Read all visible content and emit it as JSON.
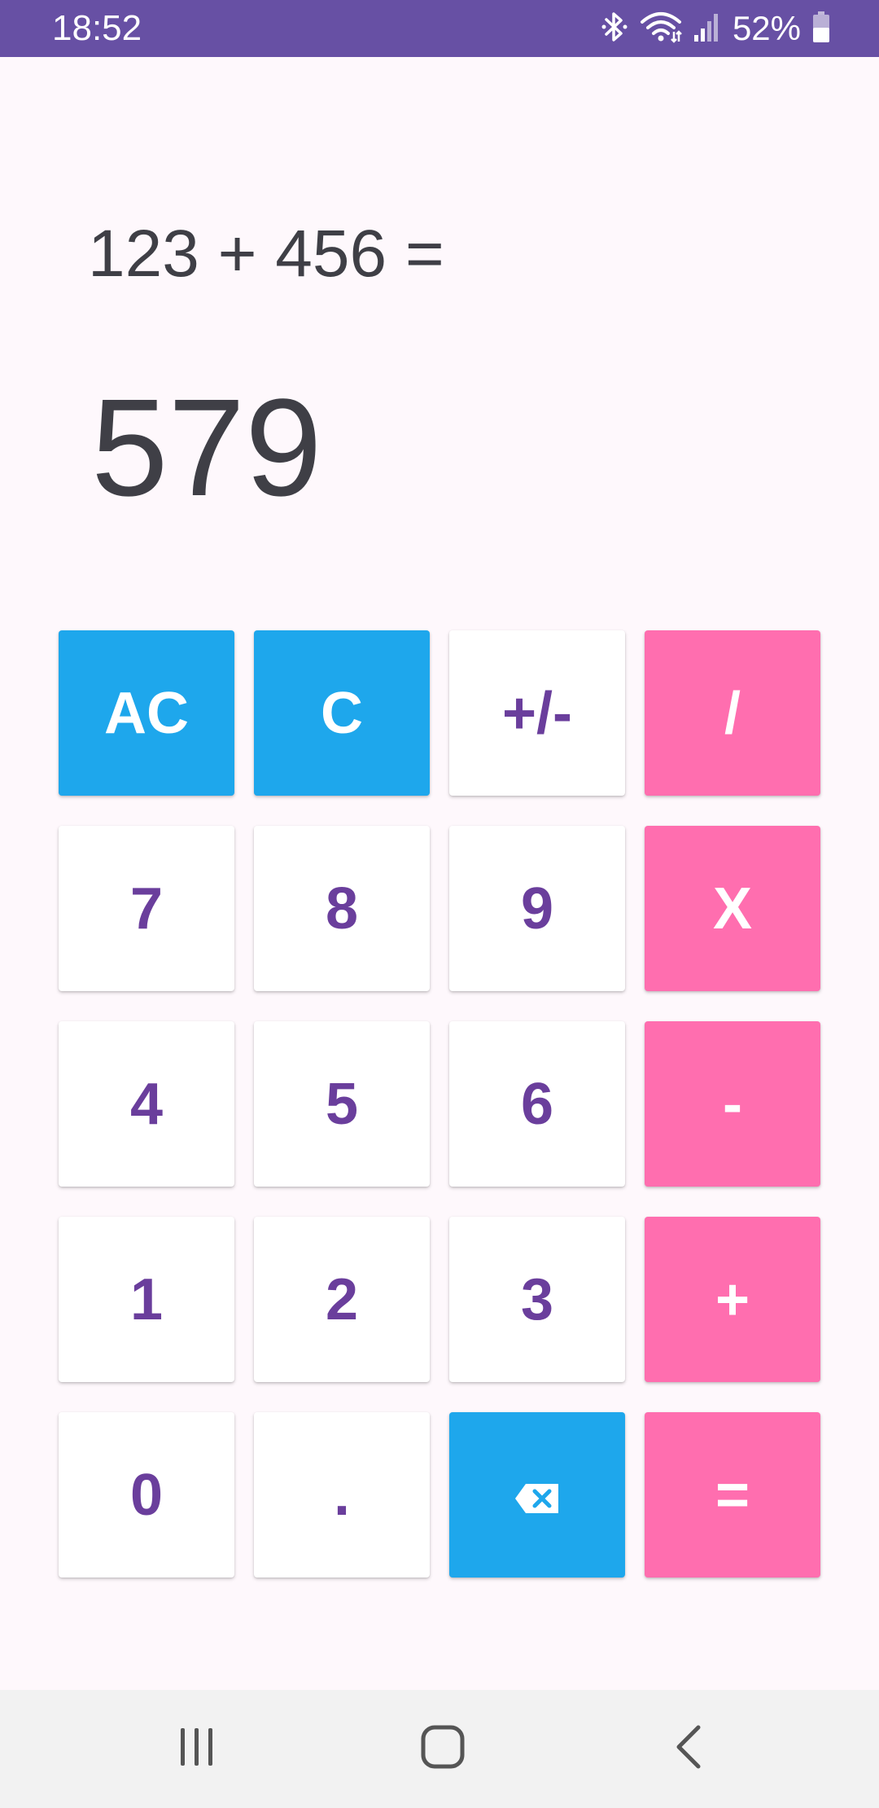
{
  "status_bar": {
    "time": "18:52",
    "battery_percent": "52%",
    "background_color": "#6750a4",
    "icons": [
      "bluetooth-icon",
      "wifi-icon",
      "signal-icon",
      "battery-icon"
    ]
  },
  "display": {
    "expression": "123 + 456 =",
    "result": "579"
  },
  "keypad": {
    "rows": [
      [
        {
          "label": "AC",
          "type": "clear"
        },
        {
          "label": "C",
          "type": "clear"
        },
        {
          "label": "+/-",
          "type": "number"
        },
        {
          "label": "/",
          "type": "op"
        }
      ],
      [
        {
          "label": "7",
          "type": "number"
        },
        {
          "label": "8",
          "type": "number"
        },
        {
          "label": "9",
          "type": "number"
        },
        {
          "label": "X",
          "type": "op"
        }
      ],
      [
        {
          "label": "4",
          "type": "number"
        },
        {
          "label": "5",
          "type": "number"
        },
        {
          "label": "6",
          "type": "number"
        },
        {
          "label": "-",
          "type": "op"
        }
      ],
      [
        {
          "label": "1",
          "type": "number"
        },
        {
          "label": "2",
          "type": "number"
        },
        {
          "label": "3",
          "type": "number"
        },
        {
          "label": "+",
          "type": "op"
        }
      ],
      [
        {
          "label": "0",
          "type": "number"
        },
        {
          "label": ".",
          "type": "number"
        },
        {
          "icon": "backspace-icon",
          "type": "action"
        },
        {
          "label": "=",
          "type": "op"
        }
      ]
    ],
    "colors": {
      "number_bg": "#ffffff",
      "number_text": "#6a3e9c",
      "clear_bg": "#1ea7ec",
      "operator_bg": "#ff6eaf"
    }
  },
  "nav_bar": {
    "buttons": [
      "recents-icon",
      "home-icon",
      "back-icon"
    ]
  }
}
